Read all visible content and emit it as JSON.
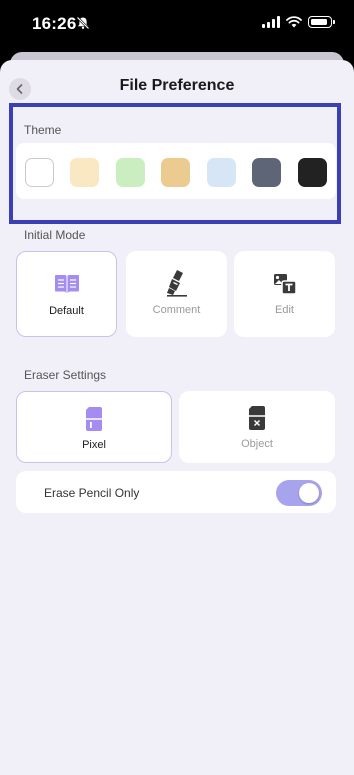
{
  "status_bar": {
    "time": "16:26",
    "icons": [
      "bell-slash-icon",
      "cellular-signal-icon",
      "wifi-icon",
      "battery-icon"
    ]
  },
  "header": {
    "title": "File Preference",
    "back_icon": "chevron-left-icon"
  },
  "theme": {
    "label": "Theme",
    "swatches": [
      {
        "name": "white",
        "color": "#ffffff",
        "border": "#c9cbd3"
      },
      {
        "name": "cream",
        "color": "#f9e8c2"
      },
      {
        "name": "light-green",
        "color": "#cbeec0"
      },
      {
        "name": "tan",
        "color": "#eccb90"
      },
      {
        "name": "light-blue",
        "color": "#d7e6f6"
      },
      {
        "name": "slate",
        "color": "#5e6576"
      },
      {
        "name": "black",
        "color": "#222222"
      }
    ],
    "highlight_color": "#3a3fb3"
  },
  "initial_mode": {
    "label": "Initial Mode",
    "selected": "Default",
    "options": [
      {
        "label": "Default",
        "icon": "open-book-icon"
      },
      {
        "label": "Comment",
        "icon": "highlighter-icon"
      },
      {
        "label": "Edit",
        "icon": "text-edit-icon"
      }
    ]
  },
  "eraser_settings": {
    "label": "Eraser Settings",
    "selected": "Pixel",
    "options": [
      {
        "label": "Pixel",
        "icon": "pixel-eraser-icon"
      },
      {
        "label": "Object",
        "icon": "object-eraser-icon"
      }
    ]
  },
  "erase_pencil_only": {
    "label": "Erase Pencil Only",
    "enabled": true
  },
  "colors": {
    "accent": "#a58cf0",
    "toggle_on": "#a7a3ec",
    "background": "#f1eff8"
  }
}
